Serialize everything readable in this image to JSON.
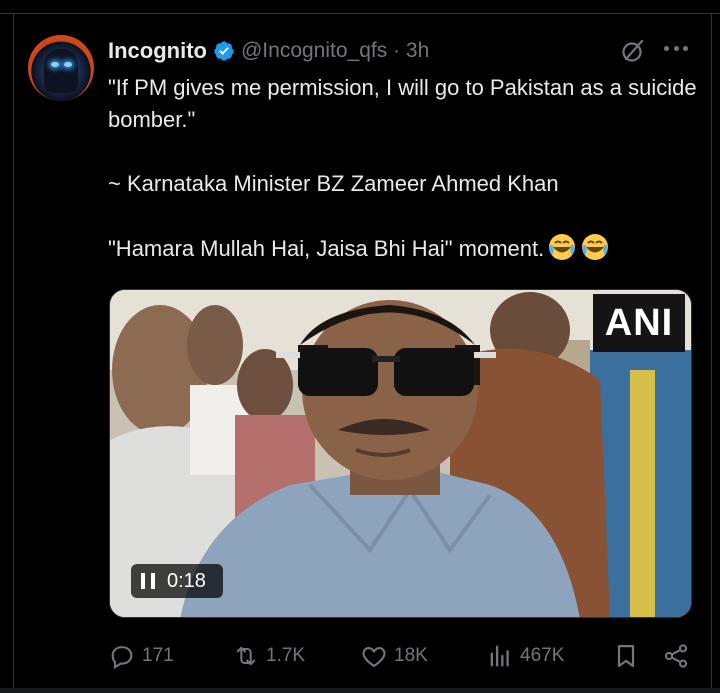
{
  "tweet": {
    "display_name": "Incognito",
    "handle_time": "@Incognito_qfs · 3h",
    "text_line1": "\"If PM gives me permission, I will go to Pakistan as a suicide bomber.\"",
    "text_line2": "~ Karnataka Minister BZ Zameer Ahmed Khan",
    "text_line3": "\"Hamara Mullah Hai, Jaisa Bhi Hai\" moment.",
    "emojis": [
      "face-with-tears-of-joy-emoji",
      "face-with-tears-of-joy-emoji"
    ]
  },
  "media": {
    "watermark": "ANI",
    "video_time": "0:18",
    "video_state_icon": "pause-icon"
  },
  "actions": {
    "replies": "171",
    "reposts": "1.7K",
    "likes": "18K",
    "views": "467K"
  },
  "colors": {
    "background": "#000000",
    "text": "#e7e9ea",
    "muted": "#71767b",
    "verified": "#1d9bf0",
    "border": "#2f3336"
  }
}
